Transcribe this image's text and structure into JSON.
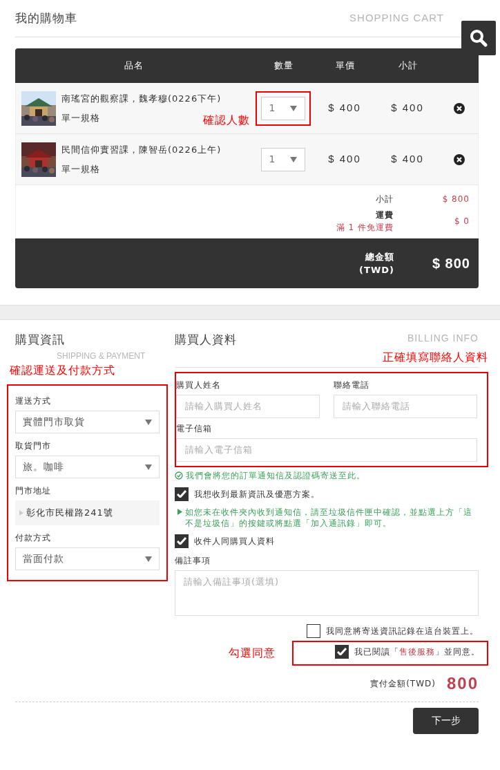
{
  "cart": {
    "title": "我的購物車",
    "subtitle": "SHOPPING CART",
    "columns": [
      "品名",
      "數量",
      "單價",
      "小計"
    ],
    "items": [
      {
        "name": "南瑤宮的觀察課，魏孝穆(0226下午)",
        "spec": "單一規格",
        "quantity": "1",
        "price": "$ 400",
        "subtotal": "$ 400",
        "highlighted": true,
        "annotation": "確認人數"
      },
      {
        "name": "民間信仰實習課，陳智岳(0226上午)",
        "spec": "單一規格",
        "quantity": "1",
        "price": "$ 400",
        "subtotal": "$ 400",
        "highlighted": false
      }
    ],
    "summary": [
      {
        "label": "小計",
        "value": "$ 800"
      },
      {
        "label": "運費",
        "note": "滿 1 件免運費",
        "value": "$ 0"
      }
    ],
    "total": {
      "label": "總金額",
      "currency": "(TWD)",
      "value": "$ 800"
    }
  },
  "shipping": {
    "title": "購買資訊",
    "subtitle": "SHIPPING & PAYMENT",
    "annotation": "確認運送及付款方式",
    "fields": [
      {
        "kind": "select",
        "label": "運送方式",
        "value": "實體門市取貨"
      },
      {
        "kind": "select",
        "label": "取貨門市",
        "value": "旅。咖啡"
      },
      {
        "kind": "static",
        "label": "門市地址",
        "value": "彰化市民權路241號"
      },
      {
        "kind": "select",
        "label": "付款方式",
        "value": "當面付款"
      }
    ]
  },
  "billing": {
    "title": "購買人資料",
    "subtitle": "BILLING INFO",
    "annotation": "正確填寫聯絡人資料",
    "fields": [
      {
        "label": "購買人姓名",
        "placeholder": "請輸入購買人姓名"
      },
      {
        "label": "聯絡電話",
        "placeholder": "請輸入聯絡電話"
      },
      {
        "label": "電子信箱",
        "placeholder": "請輸入電子信箱"
      }
    ],
    "email_note": "我們會將您的訂單通知信及認證碼寄送至此。",
    "newsletter": {
      "label": "我想收到最新資訊及優惠方案。",
      "checked": true
    },
    "spam_note": "如您未在收件夾內收到通知信，請至垃圾信件匣中確認，並點選上方「這不是垃圾信」的按鍵或將點選「加入通訊錄」即可。",
    "same_as_buyer": {
      "label": "收件人同購買人資料",
      "checked": true
    },
    "remarks": {
      "label": "備註事項",
      "placeholder": "請輸入備註事項(選填)"
    }
  },
  "agreements": [
    {
      "before": "我同意將寄送資訊記錄在這台裝置上。",
      "checked": false,
      "highlighted": false
    },
    {
      "before": "我已閱讀「",
      "link": "售後服務",
      "after": "」並同意。",
      "checked": true,
      "highlighted": true,
      "annotation": "勾選同意"
    }
  ],
  "payable": {
    "label": "實付金額(TWD)",
    "value": "800"
  },
  "next_button": "下一步"
}
